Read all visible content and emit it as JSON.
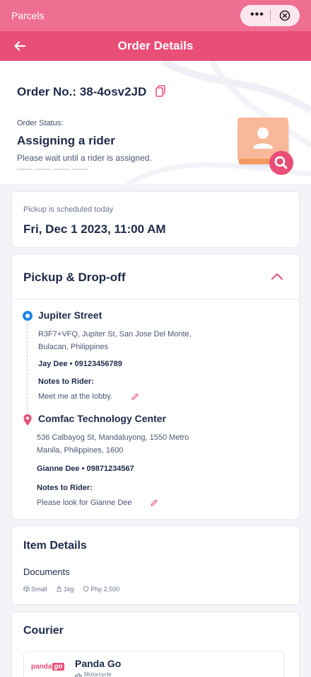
{
  "app": {
    "title": "Parcels",
    "capsule_more": "•••"
  },
  "navbar": {
    "title": "Order Details"
  },
  "order": {
    "number_label": "Order No.: 38-4osv2JD",
    "status_label": "Order Status:",
    "status_value": "Assigning a rider",
    "status_note": "Please wait until a rider is assigned."
  },
  "schedule": {
    "label": "Pickup is scheduled today",
    "value": "Fri, Dec 1 2023, 11:00 AM"
  },
  "route": {
    "title": "Pickup & Drop-off",
    "notes_label": "Notes to Rider:",
    "pickup": {
      "name": "Jupiter Street",
      "address_line1": "R3F7+VFQ, Jupiter St, San Jose Del Monte,",
      "address_line2": "Bulacan, Philippines",
      "contact": "Jay Dee  •  09123456789",
      "notes": "Meet me at the lobby."
    },
    "dropoff": {
      "name": "Comfac Technology Center",
      "address_line1": "536 Calbayog St, Mandaluyong, 1550 Metro",
      "address_line2": "Manila, Philippines, 1600",
      "contact": "Gianne Dee  •  09871234567",
      "notes": "Please look for Gianne Dee"
    }
  },
  "items": {
    "title": "Item Details",
    "kind": "Documents",
    "size": "Small",
    "weight": "1kg",
    "value": "Php 2,500"
  },
  "courier": {
    "title": "Courier",
    "logo_text": "panda",
    "logo_go": "go",
    "name": "Panda Go",
    "vehicle": "Motorcycle"
  },
  "colors": {
    "brand": "#e94e77",
    "topbar": "#ef6f92",
    "pickup_pin": "#1e88e5",
    "text": "#1e2a4a"
  },
  "icons": [
    "close-circle-icon",
    "back-arrow-icon",
    "copy-icon",
    "rider-search-icon",
    "chevron-up-icon",
    "location-pin-icon",
    "edit-pencil-icon",
    "box-icon",
    "weight-icon",
    "shield-icon",
    "motorcycle-icon"
  ]
}
